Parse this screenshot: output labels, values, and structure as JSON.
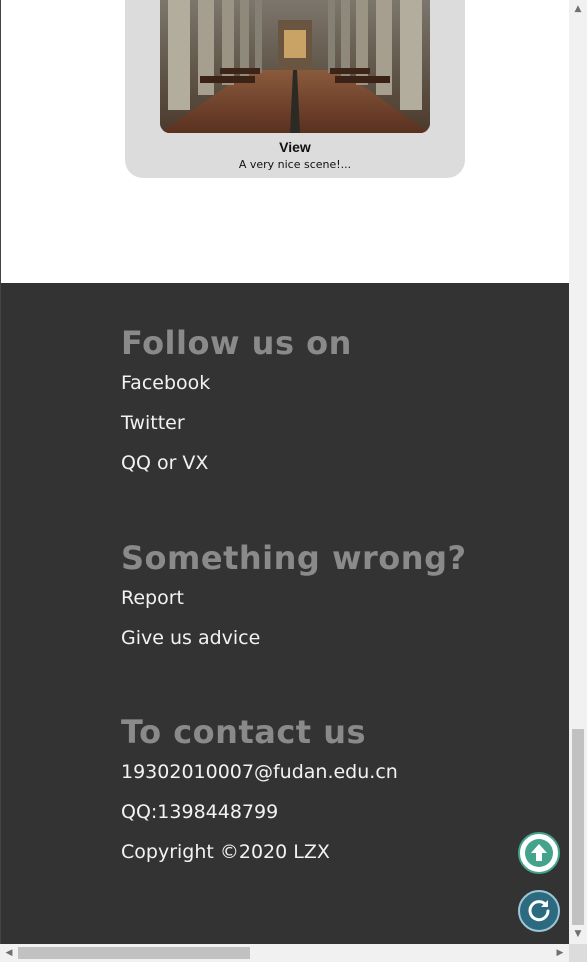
{
  "card": {
    "title": "View",
    "description": "A very nice scene!..."
  },
  "footer": {
    "sections": [
      {
        "heading": "Follow us on",
        "links": [
          "Facebook",
          "Twitter",
          "QQ or VX"
        ]
      },
      {
        "heading": "Something wrong?",
        "links": [
          "Report",
          "Give us advice"
        ]
      },
      {
        "heading": "To contact us",
        "items": [
          "19302010007@fudan.edu.cn",
          "QQ:1398448799",
          "Copyright ©2020 LZX"
        ]
      }
    ]
  },
  "colors": {
    "footer_bg": "#333333",
    "heading": "#8a8a8a",
    "link": "#f2f2f2",
    "up_button": "#45a38d",
    "refresh_button": "#2c6a80"
  },
  "icons": {
    "scroll_top": "arrow-up-icon",
    "refresh": "refresh-icon"
  }
}
